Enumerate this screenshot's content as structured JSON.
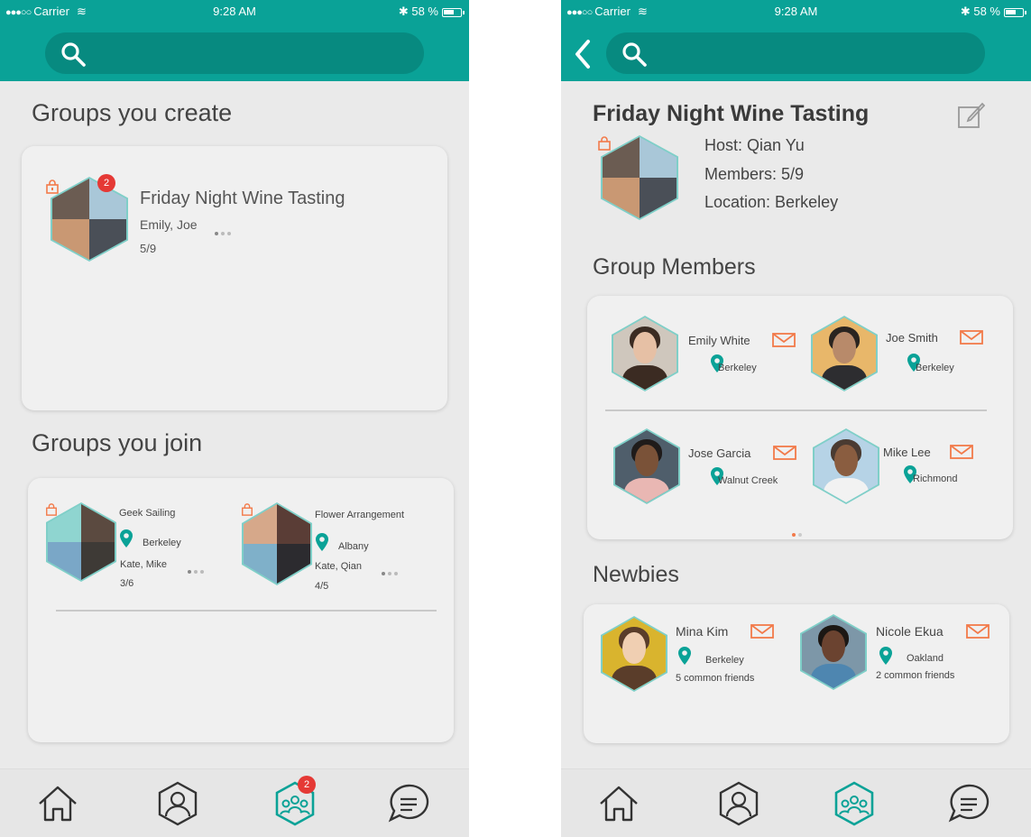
{
  "status": {
    "carrier": "Carrier",
    "time": "9:28 AM",
    "battery": "58 %"
  },
  "left": {
    "created_title": "Groups you create",
    "created": {
      "name": "Friday Night Wine Tasting",
      "members": "Emily, Joe",
      "count": "5/9",
      "badge": "2"
    },
    "joined_title": "Groups you join",
    "joined": [
      {
        "name": "Geek Sailing",
        "location": "Berkeley",
        "members": "Kate, Mike",
        "count": "3/6"
      },
      {
        "name": "Flower Arrangement",
        "location": "Albany",
        "members": "Kate, Qian",
        "count": "4/5"
      }
    ],
    "tab_badge": "2"
  },
  "right": {
    "group_name": "Friday Night Wine Tasting",
    "host": "Host: Qian Yu",
    "members": "Members: 5/9",
    "location": "Location: Berkeley",
    "members_title": "Group Members",
    "member_list": [
      {
        "name": "Emily White",
        "location": "Berkeley"
      },
      {
        "name": "Joe Smith",
        "location": "Berkeley"
      },
      {
        "name": "Jose Garcia",
        "location": "Walnut Creek"
      },
      {
        "name": "Mike Lee",
        "location": "Richmond"
      }
    ],
    "newbies_title": "Newbies",
    "newbies": [
      {
        "name": "Mina Kim",
        "location": "Berkeley",
        "friends": "5 common friends"
      },
      {
        "name": "Nicole Ekua",
        "location": "Oakland",
        "friends": "2 common friends"
      }
    ]
  },
  "icons": {
    "search": "search-icon",
    "back": "back-icon",
    "edit": "edit-icon",
    "pin": "location-pin-icon",
    "mail": "mail-icon",
    "lock": "lock-icon",
    "tabs": [
      "home-icon",
      "profile-icon",
      "groups-icon",
      "chat-icon"
    ]
  },
  "colors": {
    "teal": "#0aa297",
    "teal_dark": "#078a80",
    "accent": "#f27a4a",
    "badge": "#e53935"
  }
}
